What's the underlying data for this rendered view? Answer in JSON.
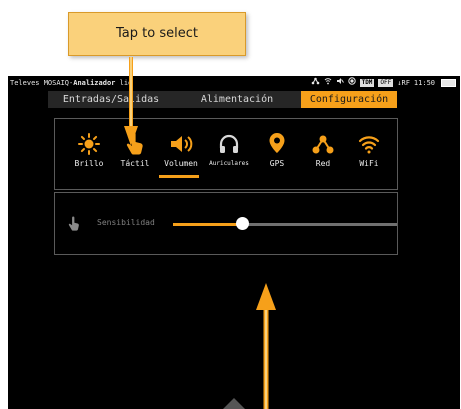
{
  "callout": {
    "text": "Tap to select"
  },
  "statusbar": {
    "brand": "Televes MOSAIQ",
    "separator": "-",
    "app_name": "Analizador",
    "app_name_rest": "lio",
    "tdm_label": "TDM",
    "off_label": "OFF",
    "rf_label": "↓RF",
    "time": "11:50",
    "icons": [
      "antenna-icon",
      "wifi-signal-icon",
      "mute-icon",
      "record-icon",
      "battery-icon"
    ]
  },
  "tabs": [
    {
      "label": "Entradas/Salidas",
      "active": false
    },
    {
      "label": "Alimentación",
      "active": false
    },
    {
      "label": "Configuración",
      "active": true
    }
  ],
  "settings_icons": [
    {
      "label": "Brillo",
      "icon": "sun-icon"
    },
    {
      "label": "Táctil",
      "icon": "hand-icon",
      "selected": true
    },
    {
      "label": "Volumen",
      "icon": "speaker-icon"
    },
    {
      "label": "Auriculares",
      "icon": "headphones-icon"
    },
    {
      "label": "GPS",
      "icon": "map-pin-icon"
    },
    {
      "label": "Red",
      "icon": "network-icon"
    },
    {
      "label": "WiFi",
      "icon": "wifi-icon"
    }
  ],
  "sensitivity": {
    "label": "Sensibilidad",
    "value_fraction": 0.31,
    "icon": "hand-icon"
  },
  "colors": {
    "accent": "#f6a01a",
    "background": "#000000",
    "callout_bg": "#fad17b",
    "arrow": "#f6a01a"
  }
}
